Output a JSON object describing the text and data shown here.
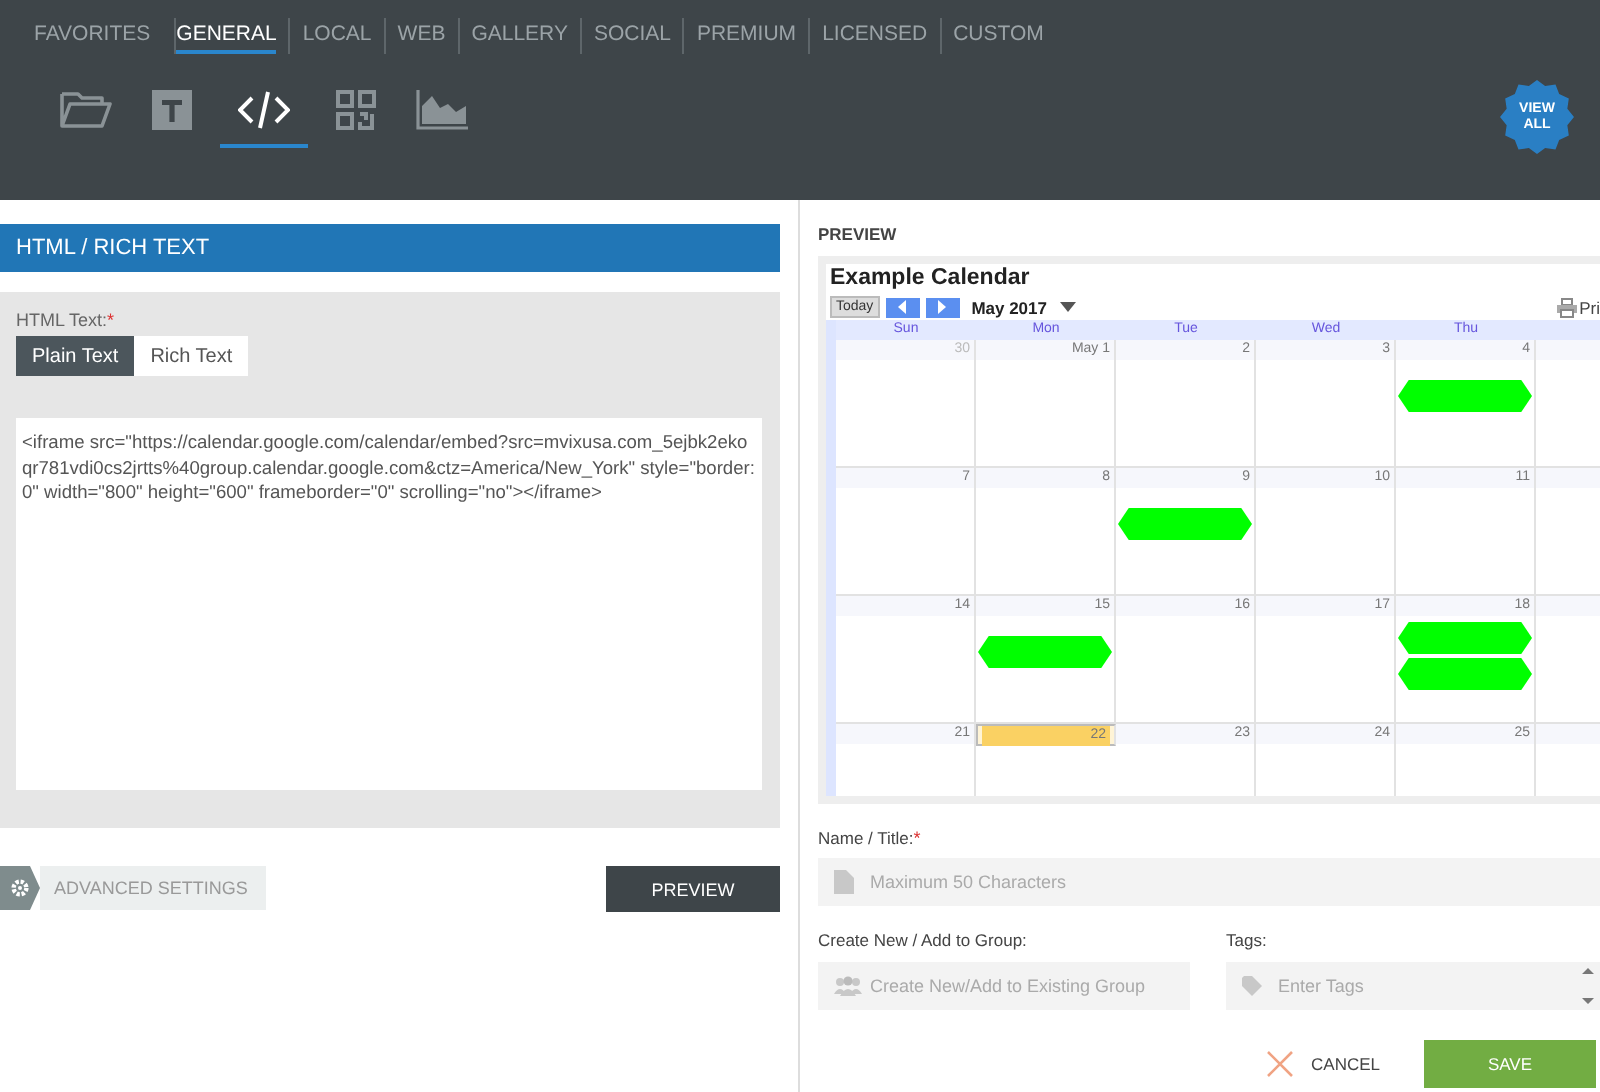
{
  "top_tabs": [
    {
      "label": "FAVORITES",
      "selected": false
    },
    {
      "label": "GENERAL",
      "selected": true
    },
    {
      "label": "LOCAL",
      "selected": false
    },
    {
      "label": "WEB",
      "selected": false
    },
    {
      "label": "GALLERY",
      "selected": false
    },
    {
      "label": "SOCIAL",
      "selected": false
    },
    {
      "label": "PREMIUM",
      "selected": false
    },
    {
      "label": "LICENSED",
      "selected": false
    },
    {
      "label": "CUSTOM",
      "selected": false
    }
  ],
  "tool_icons": [
    {
      "kind": "folder",
      "selected": false
    },
    {
      "kind": "text",
      "selected": false
    },
    {
      "kind": "code",
      "selected": true
    },
    {
      "kind": "qr",
      "selected": false
    },
    {
      "kind": "chart",
      "selected": false
    }
  ],
  "view_all_badge": "VIEW ALL",
  "editor": {
    "header": "HTML / RICH TEXT",
    "field_label": "HTML Text:",
    "required_mark": "*",
    "modes": [
      {
        "label": "Plain Text",
        "selected": true
      },
      {
        "label": "Rich Text",
        "selected": false
      }
    ],
    "value": "<iframe src=\"https://calendar.google.com/calendar/embed?src=mvixusa.com_5ejbk2ekoqr781vdi0cs2jrtts%40group.calendar.google.com&ctz=America/New_York\" style=\"border: 0\" width=\"800\" height=\"600\" frameborder=\"0\" scrolling=\"no\"></iframe>"
  },
  "advanced_settings": "ADVANCED SETTINGS",
  "preview_button": "PREVIEW",
  "preview": {
    "heading": "PREVIEW",
    "calendar": {
      "title": "Example Calendar",
      "today_button": "Today",
      "month": "May 2017",
      "print": "Pri",
      "weekdays": [
        "Sun",
        "Mon",
        "Tue",
        "Wed",
        "Thu"
      ],
      "weeks": [
        [
          {
            "label": "30",
            "other_month": true,
            "today": false
          },
          {
            "label": "May 1",
            "other_month": false,
            "today": false
          },
          {
            "label": "2",
            "other_month": false,
            "today": false
          },
          {
            "label": "3",
            "other_month": false,
            "today": false
          },
          {
            "label": "4",
            "other_month": false,
            "today": false,
            "events": [
              {
                "kind": "bar"
              }
            ]
          }
        ],
        [
          {
            "label": "7",
            "other_month": false,
            "today": false
          },
          {
            "label": "8",
            "other_month": false,
            "today": false
          },
          {
            "label": "9",
            "other_month": false,
            "today": false,
            "events": [
              {
                "kind": "bar"
              }
            ]
          },
          {
            "label": "10",
            "other_month": false,
            "today": false
          },
          {
            "label": "11",
            "other_month": false,
            "today": false
          }
        ],
        [
          {
            "label": "14",
            "other_month": false,
            "today": false
          },
          {
            "label": "15",
            "other_month": false,
            "today": false,
            "events": [
              {
                "kind": "bar"
              }
            ]
          },
          {
            "label": "16",
            "other_month": false,
            "today": false
          },
          {
            "label": "17",
            "other_month": false,
            "today": false
          },
          {
            "label": "18",
            "other_month": false,
            "today": false,
            "events": [
              {
                "kind": "bar"
              },
              {
                "kind": "bar"
              }
            ]
          }
        ],
        [
          {
            "label": "21",
            "other_month": false,
            "today": false
          },
          {
            "label": "22",
            "other_month": false,
            "today": true
          },
          {
            "label": "23",
            "other_month": false,
            "today": false
          },
          {
            "label": "24",
            "other_month": false,
            "today": false
          },
          {
            "label": "25",
            "other_month": false,
            "today": false
          }
        ]
      ]
    }
  },
  "form": {
    "name_label": "Name / Title:",
    "name_required_mark": "*",
    "name_placeholder": "Maximum 50 Characters",
    "group_label": "Create New / Add to Group:",
    "group_placeholder": "Create New/Add to Existing Group",
    "tags_label": "Tags:",
    "tags_placeholder": "Enter Tags",
    "cancel": "CANCEL",
    "save": "SAVE"
  }
}
